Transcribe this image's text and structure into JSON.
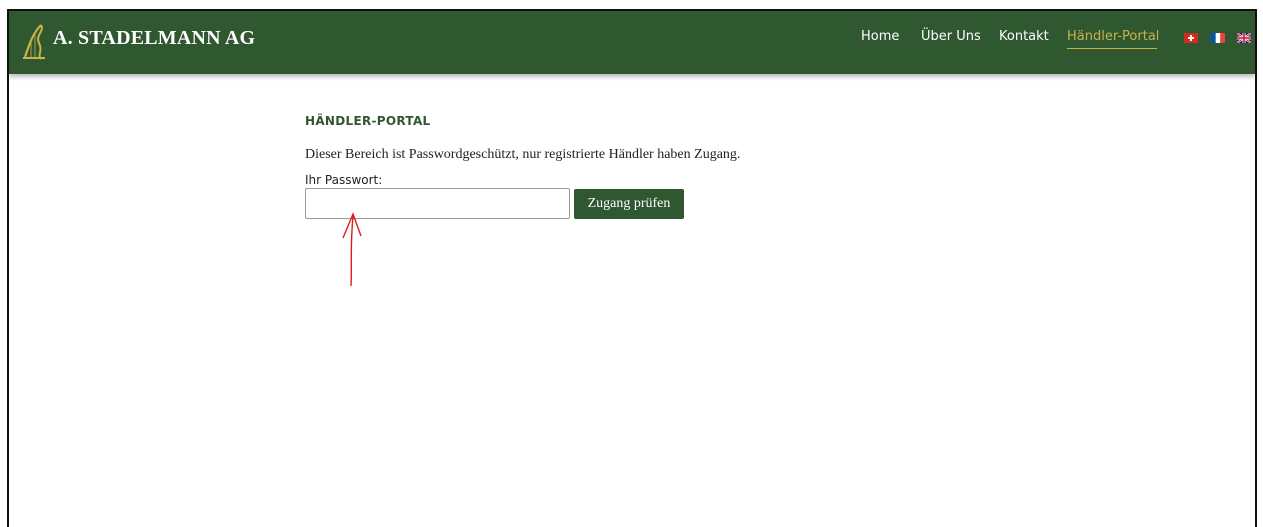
{
  "header": {
    "brand": "A. STADELMANN AG",
    "nav": [
      "Home",
      "Über Uns",
      "Kontakt",
      "Händler-Portal"
    ],
    "active_nav": "Händler-Portal",
    "languages": [
      "de-CH",
      "fr",
      "en"
    ]
  },
  "main": {
    "heading": "HÄNDLER-PORTAL",
    "description": "Dieser Bereich ist Passwordgeschützt, nur registrierte Händler haben Zugang.",
    "password_label": "Ihr Passwort:",
    "password_value": "",
    "submit_label": "Zugang prüfen"
  },
  "colors": {
    "primary_green": "#2f5730",
    "gold": "#c9b24a",
    "annotation_red": "#e01b1b"
  }
}
